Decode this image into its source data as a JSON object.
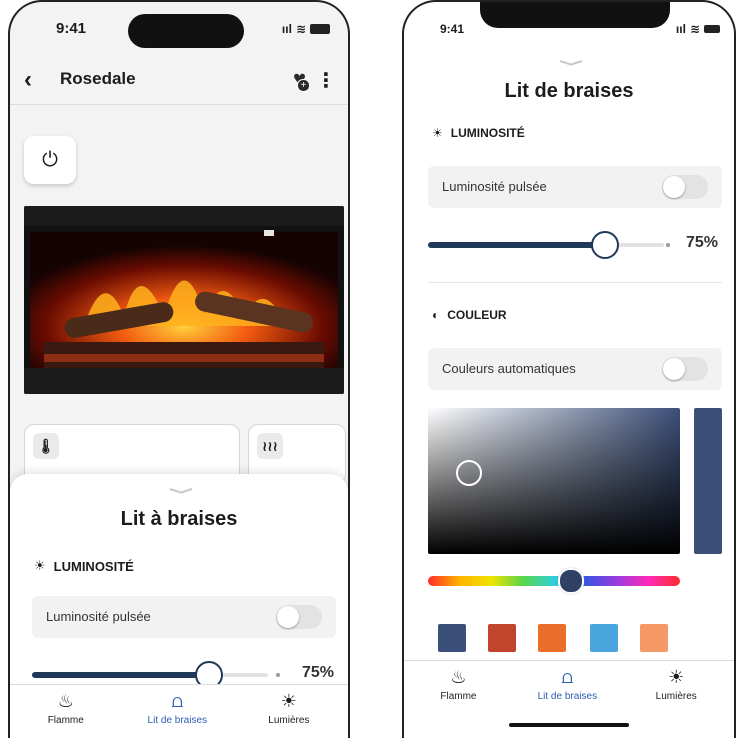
{
  "phone1": {
    "status": {
      "time": "9:41"
    },
    "header": {
      "title": "Rosedale",
      "back_icon": "chevron-left-icon",
      "favorite_icon": "heart-plus-icon",
      "menu_icon": "kebab-icon"
    },
    "power_icon": "power-icon",
    "tiles": [
      {
        "icon": "thermometer-icon"
      },
      {
        "icon": "heat-icon"
      }
    ],
    "sheet": {
      "title": "Lit à braises",
      "brightness": {
        "heading": "LUMINOSITÉ",
        "toggle_label": "Luminosité pulsée",
        "toggle_on": false,
        "value_label": "75%",
        "level": 0.75
      }
    }
  },
  "phone2": {
    "status": {
      "time": "9:41"
    },
    "sheet": {
      "title": "Lit de braises",
      "brightness": {
        "heading": "LUMINOSITÉ",
        "toggle_label": "Luminosité pulsée",
        "toggle_on": false,
        "value_label": "75%",
        "level": 0.75
      },
      "color": {
        "heading": "COULEUR",
        "toggle_label": "Couleurs automatiques",
        "toggle_on": false,
        "selected_color": "#3c4f78",
        "swatches": [
          "#3a4f7a",
          "#c0452c",
          "#ea6d2a",
          "#4aa4dd",
          "#f49966"
        ]
      }
    }
  },
  "tabs": [
    {
      "label": "Flamme",
      "icon": "flame-icon"
    },
    {
      "label": "Lit de braises",
      "icon": "ember-icon",
      "active": true
    },
    {
      "label": "Lumières",
      "icon": "sun-icon"
    }
  ]
}
